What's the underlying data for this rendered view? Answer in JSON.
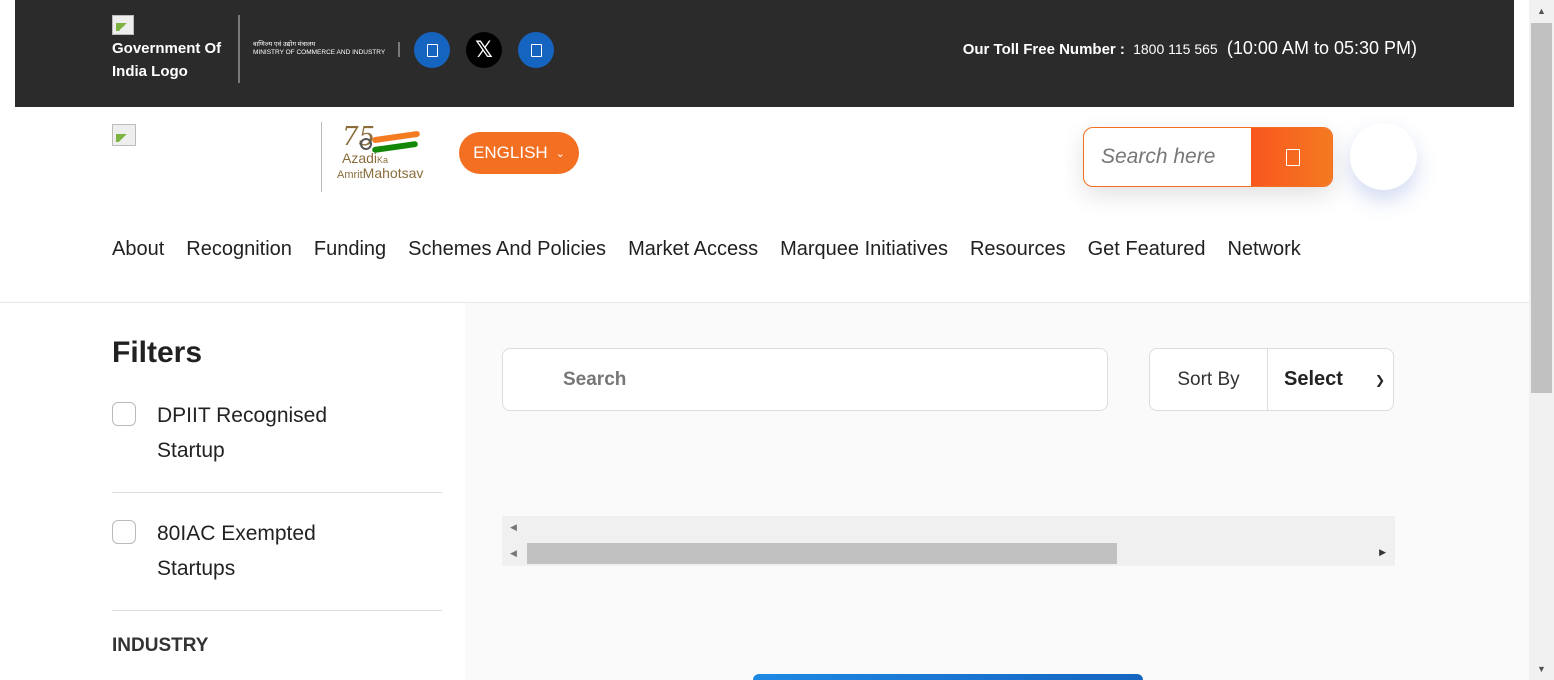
{
  "topbar": {
    "gov_logo_alt": "Government Of India Logo",
    "ministry_hindi": "वाणिज्य एवं उद्योग मंत्रालय",
    "ministry_english": "MINISTRY OF COMMERCE AND INDUSTRY",
    "social": [
      {
        "name": "facebook-icon"
      },
      {
        "name": "x-twitter-icon",
        "glyph": "𝕏"
      },
      {
        "name": "linkedin-icon"
      }
    ],
    "toll_free_label": "Our Toll Free Number :",
    "toll_free_number": "1800 115 565",
    "toll_free_hours": "(10:00 AM to 05:30 PM)"
  },
  "header": {
    "azadi": {
      "number": "75",
      "line1": "Azadi",
      "ka": "Ka",
      "line2a": "Amrit",
      "line2b": "Mahotsav"
    },
    "language_label": "ENGLISH",
    "search_placeholder": "Search here"
  },
  "nav": {
    "items": [
      "About",
      "Recognition",
      "Funding",
      "Schemes And Policies",
      "Market Access",
      "Marquee Initiatives",
      "Resources",
      "Get Featured",
      "Network"
    ]
  },
  "filters": {
    "title": "Filters",
    "options": [
      {
        "line1": "DPIIT Recognised",
        "line2": "Startup",
        "checked": false
      },
      {
        "line1": "80IAC Exempted",
        "line2": "Startups",
        "checked": false
      }
    ],
    "industry_label": "INDUSTRY"
  },
  "main": {
    "search_placeholder": "Search",
    "sort_label": "Sort By",
    "sort_value": "Select"
  },
  "colors": {
    "topbar_bg": "#2b2b2b",
    "accent_orange": "#f36f22",
    "social_blue": "#1565c0"
  }
}
